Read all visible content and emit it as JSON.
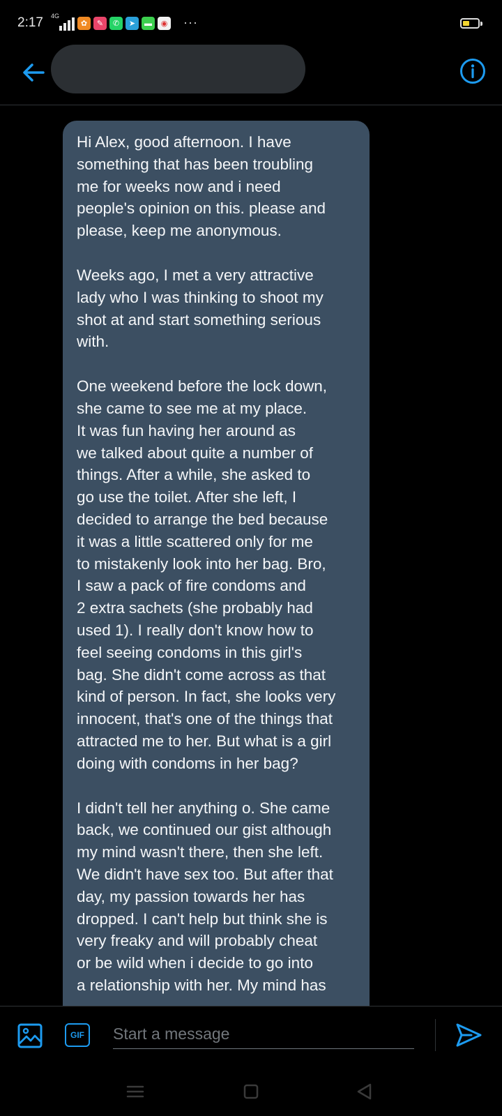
{
  "status_bar": {
    "time": "2:17",
    "network": "4G",
    "app_icons": [
      {
        "name": "app-icon-orange",
        "color": "#f08a24",
        "glyph": "✿"
      },
      {
        "name": "app-icon-pink",
        "color": "#e9456a",
        "glyph": "✎"
      },
      {
        "name": "whatsapp-icon",
        "color": "#25d366",
        "glyph": "✆"
      },
      {
        "name": "telegram-icon",
        "color": "#2aa0da",
        "glyph": "➤"
      },
      {
        "name": "messages-icon",
        "color": "#3ccf4e",
        "glyph": "▬"
      },
      {
        "name": "chrome-icon",
        "color": "#f2f2f2",
        "glyph": "◉"
      }
    ],
    "more": "···",
    "battery_level": 0.45,
    "battery_color": "#f2d530"
  },
  "header": {
    "back_icon": "arrow-left-icon",
    "info_icon": "info-circle-icon",
    "accent": "#1d9bf0"
  },
  "message": {
    "bubble_color": "#3c4f62",
    "paragraphs": [
      "Hi Alex, good afternoon. I have\nsomething that has been troubling\nme for weeks now and i need\npeople's opinion on this. please and\nplease, keep me anonymous.",
      "Weeks ago, I met a very attractive\nlady who I was thinking to shoot my\nshot at and start something serious\nwith.",
      "One weekend before the lock down,\nshe came to see me at my place.\nIt was fun having her around as\nwe talked about quite a number of\nthings. After a while, she asked to\ngo use the toilet. After she left, I\ndecided to arrange the bed because\nit was a little scattered only for me\nto mistakenly look into her bag. Bro,\nI saw a pack of fire condoms and\n2 extra sachets (she probably had\nused 1). I really don't know how to\nfeel seeing condoms in this girl's\nbag. She didn't come across as that\nkind of person. In fact, she looks very\ninnocent, that's one of the things that\nattracted me to her. But what is a girl\ndoing with condoms in her bag?",
      "I didn't tell her anything o. She came\nback, we continued our gist although\nmy mind wasn't there, then she left.\nWe didn't have sex too. But after that\nday, my passion towards her has\ndropped. I can't help but think she is\nvery freaky and will probably cheat\nor be wild when i decide to go into\na relationship with her. My mind has"
    ]
  },
  "composer": {
    "placeholder": "Start a message",
    "gif_label": "GIF",
    "media_icon": "image-icon",
    "send_icon": "send-icon"
  },
  "nav_bar": {
    "menu_icon": "menu-icon",
    "home_icon": "home-square-icon",
    "back_icon": "back-triangle-icon"
  }
}
